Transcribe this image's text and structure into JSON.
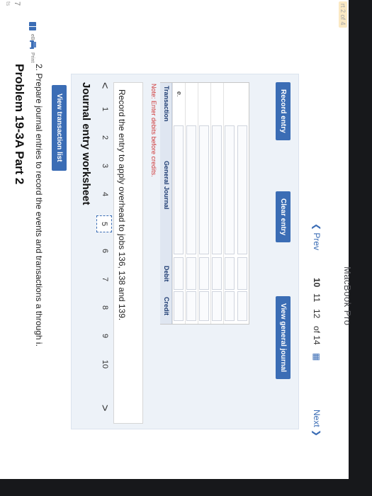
{
  "header": {
    "part_indicator": "rt 2 of 4",
    "points_value": "7",
    "points_label": "ts"
  },
  "sidebar": {
    "items": [
      {
        "label": "eBook",
        "icon": "book-icon"
      },
      {
        "label": "Print",
        "icon": "print-icon"
      }
    ]
  },
  "problem": {
    "title": "Problem 19-3A Part 2",
    "instructions": "2. Prepare journal entries to record the events and transactions a through i."
  },
  "buttons": {
    "view_transaction_list": "View transaction list",
    "record_entry": "Record entry",
    "clear_entry": "Clear entry",
    "view_general_journal": "View general journal"
  },
  "worksheet": {
    "title": "Journal entry worksheet",
    "nav_prev": "<",
    "nav_next": ">",
    "pages": [
      "1",
      "2",
      "3",
      "4",
      "5",
      "6",
      "7",
      "8",
      "9",
      "10"
    ],
    "active_page": "5",
    "task": "Record the entry to apply overhead to jobs 136, 138 and 139.",
    "note": "Note: Enter debits before credits.",
    "table": {
      "headers": [
        "Transaction",
        "General Journal",
        "Debit",
        "Credit"
      ],
      "rows": [
        {
          "transaction": "e.",
          "account": "",
          "debit": "",
          "credit": ""
        },
        {
          "transaction": "",
          "account": "",
          "debit": "",
          "credit": ""
        },
        {
          "transaction": "",
          "account": "",
          "debit": "",
          "credit": ""
        },
        {
          "transaction": "",
          "account": "",
          "debit": "",
          "credit": ""
        },
        {
          "transaction": "",
          "account": "",
          "debit": "",
          "credit": ""
        },
        {
          "transaction": "",
          "account": "",
          "debit": "",
          "credit": ""
        }
      ]
    }
  },
  "pager": {
    "prev": "Prev",
    "pages": [
      "10",
      "11",
      "12"
    ],
    "current_page": "11",
    "of_text": "of 14",
    "next": "Next"
  },
  "device": {
    "label": "MacBook Pro"
  },
  "colors": {
    "accent": "#3b6db5",
    "note": "#cf3a3a",
    "bezel": "#17181b"
  }
}
